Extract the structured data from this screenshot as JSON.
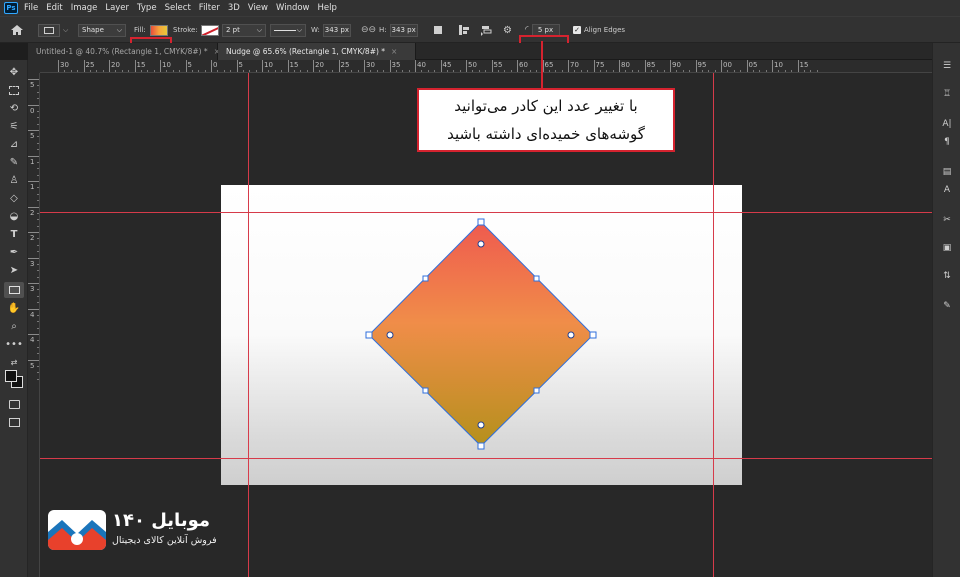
{
  "app": {
    "logo_text": "Ps"
  },
  "menu": [
    "File",
    "Edit",
    "Image",
    "Layer",
    "Type",
    "Select",
    "Filter",
    "3D",
    "View",
    "Window",
    "Help"
  ],
  "options": {
    "shape_mode": "Shape",
    "fill_label": "Fill:",
    "stroke_label": "Stroke:",
    "stroke_width": "2 pt",
    "width_label": "W:",
    "width_value": "343 px",
    "height_label": "H:",
    "height_value": "343 px",
    "corner_radius": "5 px",
    "align_edges_label": "Align Edges",
    "align_edges_checked": true
  },
  "tabs": [
    {
      "label": "Untitled-1 @ 40.7% (Rectangle 1, CMYK/8#) *",
      "active": false,
      "close": "×"
    },
    {
      "label": "Nudge @ 65.6% (Rectangle 1, CMYK/8#) *",
      "active": true,
      "close": "×"
    }
  ],
  "ruler_h": [
    "30",
    "25",
    "20",
    "15",
    "10",
    "5",
    "0",
    "5",
    "10",
    "15",
    "20",
    "25",
    "30",
    "35",
    "40",
    "45",
    "50",
    "55",
    "60",
    "65",
    "70",
    "75",
    "80",
    "85",
    "90",
    "95",
    "00",
    "05",
    "10",
    "15"
  ],
  "ruler_v": [
    "5",
    "0",
    "5",
    "1",
    "1",
    "2",
    "2",
    "3",
    "3",
    "4",
    "4",
    "5"
  ],
  "callout": {
    "line1": "با تغییر عدد این کادر می‌توانید",
    "line2": "گوشه‌های خمیده‌ای داشته باشید"
  },
  "watermark": {
    "name": "موبایل ۱۴۰",
    "tagline": "فروش آنلاین کالای دیجیتال"
  },
  "colors": {
    "highlight": "#d5232f",
    "guide": "#d63b4a",
    "shape_top": "#ef5a4f",
    "shape_mid": "#f08d49",
    "shape_bottom": "#b5901c",
    "path": "#2f6fdc"
  }
}
